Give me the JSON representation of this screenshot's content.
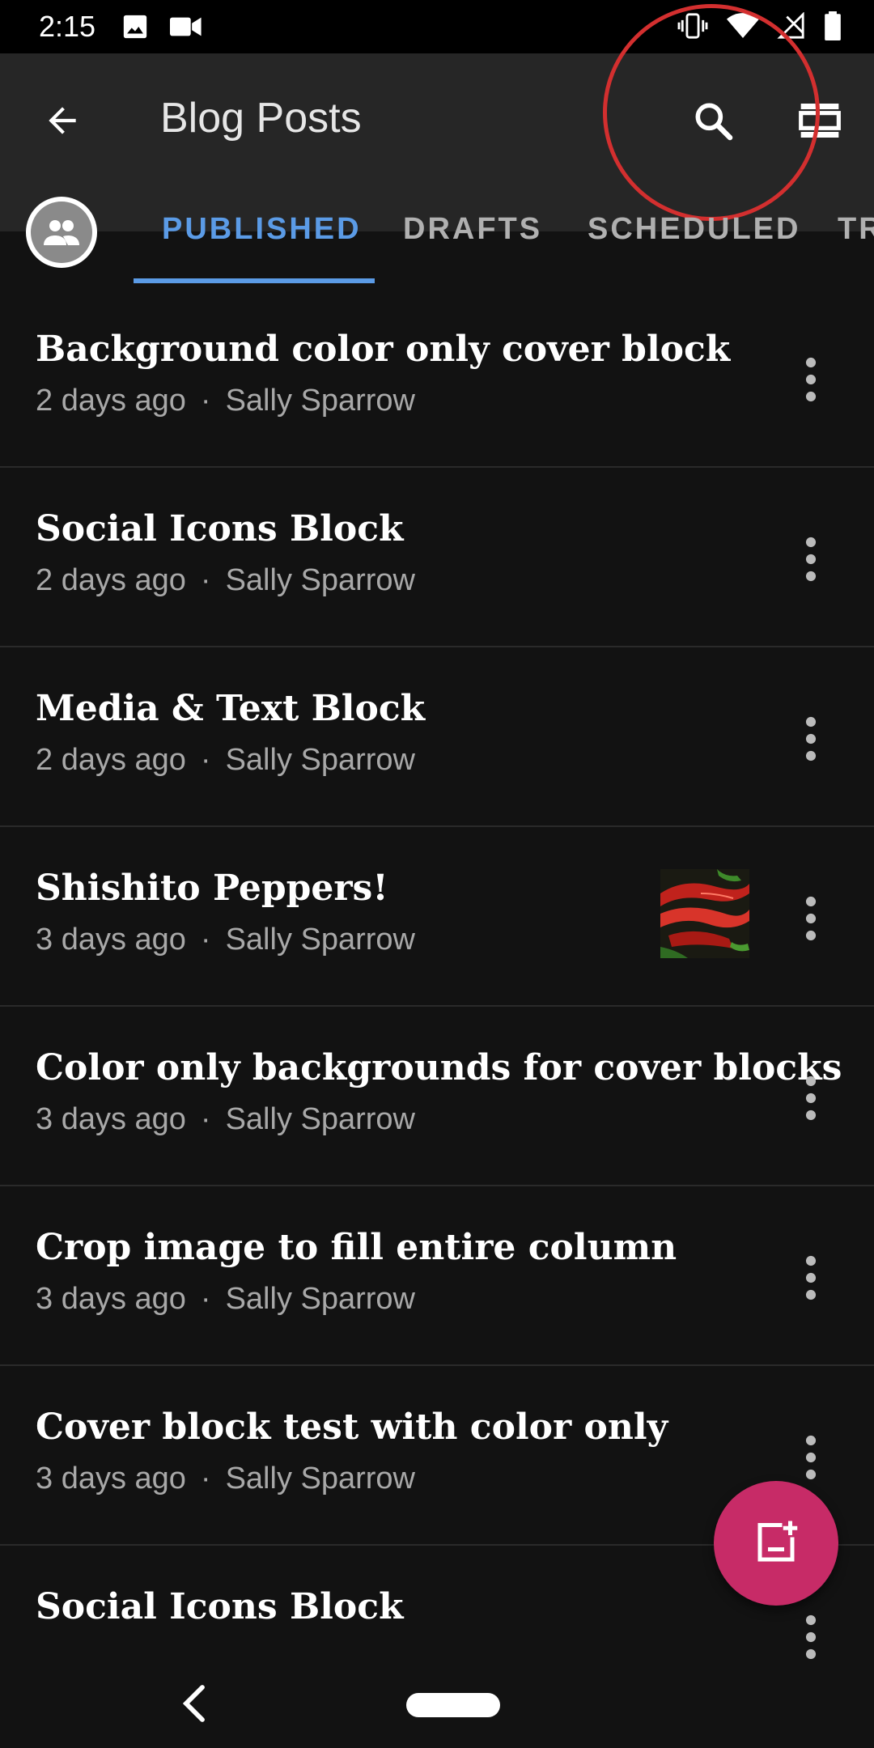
{
  "status": {
    "time": "2:15",
    "icons": [
      "image-icon",
      "video-camera-icon",
      "vibrate-icon",
      "wifi-icon",
      "signal-icon",
      "battery-icon"
    ]
  },
  "app_bar": {
    "title": "Blog Posts",
    "back_icon": "arrow-back-icon",
    "search_icon": "search-icon",
    "layout_icon": "layout-toggle-icon"
  },
  "tabs": [
    {
      "label": "PUBLISHED",
      "active": true
    },
    {
      "label": "DRAFTS",
      "active": false
    },
    {
      "label": "SCHEDULED",
      "active": false
    },
    {
      "label": "TR",
      "active": false
    }
  ],
  "posts": [
    {
      "title": "Background color only cover block",
      "age": "2 days ago",
      "separator": "·",
      "author": "Sally Sparrow"
    },
    {
      "title": "Social Icons Block",
      "age": "2 days ago",
      "separator": "·",
      "author": "Sally Sparrow"
    },
    {
      "title": "Media & Text Block",
      "age": "2 days ago",
      "separator": "·",
      "author": "Sally Sparrow"
    },
    {
      "title": "Shishito Peppers!",
      "age": "3 days ago",
      "separator": "·",
      "author": "Sally Sparrow",
      "has_thumbnail": true
    },
    {
      "title": "Color only backgrounds for cover blocks",
      "age": "3 days ago",
      "separator": "·",
      "author": "Sally Sparrow"
    },
    {
      "title": "Crop image to fill entire column",
      "age": "3 days ago",
      "separator": "·",
      "author": "Sally Sparrow"
    },
    {
      "title": "Cover block test with color only",
      "age": "3 days ago",
      "separator": "·",
      "author": "Sally Sparrow"
    },
    {
      "title": "Social Icons Block",
      "age": "",
      "separator": "",
      "author": ""
    }
  ],
  "colors": {
    "accent": "#5b9be6",
    "fab": "#c72b67",
    "background": "#121212",
    "app_bar": "#262626",
    "highlight": "#d32f2f"
  }
}
